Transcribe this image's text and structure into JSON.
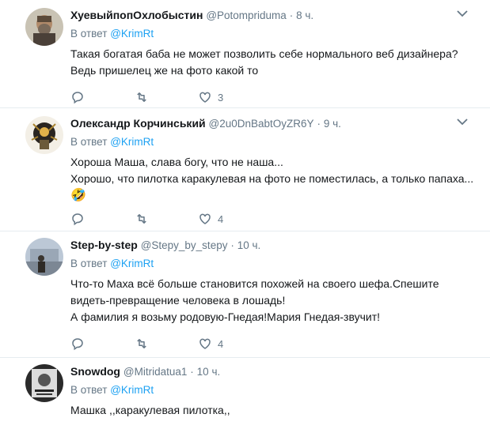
{
  "tweets": [
    {
      "name": "ХуевыйпопОхлобыстин",
      "handle": "@Potompriduma",
      "time": "8 ч.",
      "reply_prefix": "В ответ",
      "reply_to": "@KrimRt",
      "lines": [
        "Такая богатая баба не может позволить себе нормального веб дизайнера?",
        "Ведь пришелец же на фото какой то"
      ],
      "emoji": "",
      "likes": "3"
    },
    {
      "name": "Олександр Корчинський",
      "handle": "@2u0DnBabtOyZR6Y",
      "time": "9 ч.",
      "reply_prefix": "В ответ",
      "reply_to": "@KrimRt",
      "lines": [
        "Хороша Маша, слава богу, что не наша...",
        "Хорошо, что пилотка каракулевая на фото не поместилась, а только папаха..."
      ],
      "emoji": "🤣",
      "likes": "4"
    },
    {
      "name": "Step-by-step",
      "handle": "@Stepy_by_stepy",
      "time": "10 ч.",
      "reply_prefix": "В ответ",
      "reply_to": "@KrimRt",
      "lines": [
        "Что-то Маха всё больше становится похожей на своего шефа.Спешите",
        "видеть-превращение человека в лошадь!",
        "А фамилия я возьму родовую-Гнедая!Мария Гнедая-звучит!"
      ],
      "emoji": "",
      "likes": "4"
    },
    {
      "name": "Snowdog",
      "handle": "@Mitridatua1",
      "time": "10 ч.",
      "reply_prefix": "В ответ",
      "reply_to": "@KrimRt",
      "lines": [
        "Машка ,,каракулевая пилотка,,"
      ],
      "emoji": "",
      "likes": ""
    }
  ],
  "colors": {
    "link": "#1da1f2",
    "muted": "#657786",
    "text": "#14171a",
    "divider": "#e6ecf0"
  }
}
